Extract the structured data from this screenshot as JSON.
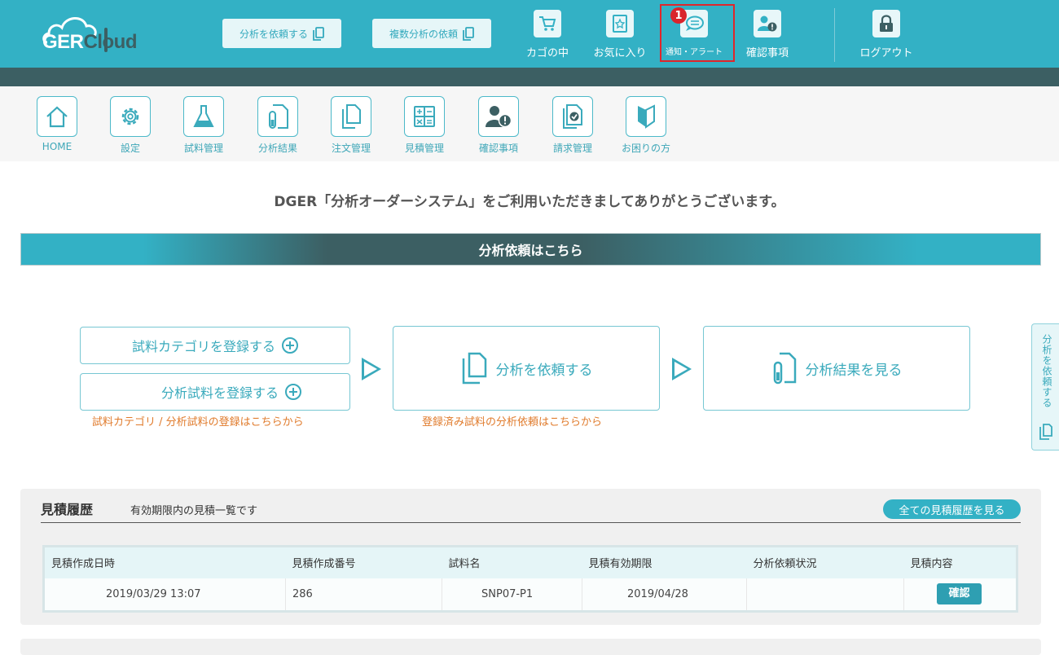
{
  "brand": {
    "logo_white": "GER",
    "logo_dark": "Cloud",
    "accent": "#33b1c5",
    "dark": "#3c5f63",
    "alert": "#e0262b"
  },
  "header": {
    "request_analysis_btn": "分析を依頼する",
    "request_multi_btn": "複数分析の依頼",
    "icons": [
      {
        "label": "カゴの中",
        "icon": "cart-icon"
      },
      {
        "label": "お気に入り",
        "icon": "star-book-icon"
      },
      {
        "label": "通知・アラート",
        "icon": "speech-bubble-icon"
      },
      {
        "label": "確認事項",
        "icon": "user-alert-icon"
      },
      {
        "label": "ログアウト",
        "icon": "lock-icon"
      }
    ],
    "notification_count": "1"
  },
  "nav": [
    {
      "label": "HOME",
      "icon": "home-icon"
    },
    {
      "label": "設定",
      "icon": "gear-icon"
    },
    {
      "label": "試料管理",
      "icon": "flask-icon"
    },
    {
      "label": "分析結果",
      "icon": "test-tube-doc-icon"
    },
    {
      "label": "注文管理",
      "icon": "documents-icon"
    },
    {
      "label": "見積管理",
      "icon": "calculator-icon"
    },
    {
      "label": "確認事項",
      "icon": "user-alert-icon"
    },
    {
      "label": "請求管理",
      "icon": "check-doc-icon"
    },
    {
      "label": "お困りの方",
      "icon": "beginner-icon"
    }
  ],
  "main": {
    "welcome": "DGER「分析オーダーシステム」をご利用いただきましてありがとうございます。",
    "banner": "分析依頼はこちら",
    "flow": {
      "register_category": "試料カテゴリを登録する",
      "register_sample": "分析試料を登録する",
      "register_note": "試料カテゴリ / 分析試料の登録はこちらから",
      "request": "分析を依頼する",
      "request_note": "登録済み試料の分析依頼はこちらから",
      "view_results": "分析結果を見る"
    },
    "side_tab": "分析を依頼する"
  },
  "estimates": {
    "title": "見積履歴",
    "subtitle": "有効期限内の見積一覧です",
    "view_all": "全ての見積履歴を見る",
    "columns": [
      "見積作成日時",
      "見積作成番号",
      "試料名",
      "見積有効期限",
      "分析依頼状況",
      "見積内容"
    ],
    "rows": [
      {
        "created": "2019/03/29 13:07",
        "number": "286",
        "sample": "SNP07-P1",
        "expires": "2019/04/28",
        "status": "",
        "action": "確認"
      }
    ]
  }
}
